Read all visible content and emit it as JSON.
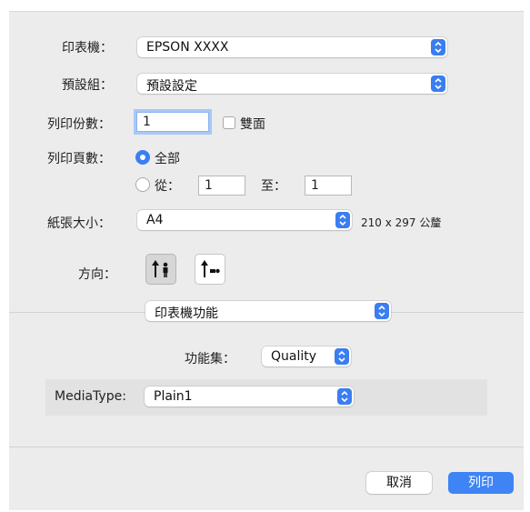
{
  "printer": {
    "label": "印表機：",
    "value": "EPSON XXXX"
  },
  "presets": {
    "label": "預設組：",
    "value": "預設設定"
  },
  "copies": {
    "label": "列印份數：",
    "value": "1",
    "duplex_label": "雙面"
  },
  "pages": {
    "label": "列印頁數：",
    "all_label": "全部",
    "from_label": "從：",
    "from_value": "1",
    "to_label": "至：",
    "to_value": "1"
  },
  "paper": {
    "label": "紙張大小：",
    "value": "A4",
    "dimensions": "210 x 297 公釐"
  },
  "orientation": {
    "label": "方向："
  },
  "section_menu": {
    "value": "印表機功能"
  },
  "feature_set": {
    "label": "功能集：",
    "value": "Quality"
  },
  "media_type": {
    "label": "MediaType:",
    "value": "Plain1"
  },
  "buttons": {
    "cancel": "取消",
    "print": "列印"
  },
  "colors": {
    "accent": "#3a7ef2",
    "dialog_bg": "#ececec"
  }
}
